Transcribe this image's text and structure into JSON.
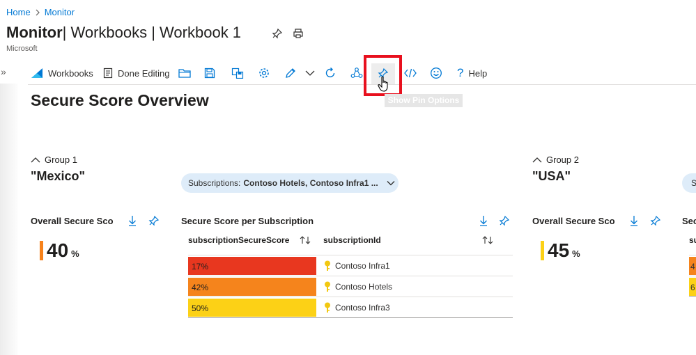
{
  "breadcrumb": {
    "home": "Home",
    "sep": ">",
    "current": "Monitor"
  },
  "title": {
    "main": "Monitor",
    "rest": " | Workbooks | Workbook 1"
  },
  "publisher": "Microsoft",
  "toolbar": {
    "expand_glyph": "»",
    "workbooks_label": "Workbooks",
    "done_editing_label": "Done Editing",
    "help_label": "Help",
    "tooltip": "Show Pin Options"
  },
  "overview_title": "Secure Score Overview",
  "groups": [
    {
      "header": "Group 1",
      "name": "\"Mexico\"",
      "overall_title": "Overall Secure Scor",
      "score": "40",
      "score_unit": "%",
      "score_color": "#f7821b",
      "subscriptions_label": "Subscriptions:",
      "subscriptions_value": "Contoso Hotels, Contoso Infra1 ...",
      "table_title": "Secure Score per Subscription",
      "columns": [
        "subscriptionSecureScore",
        "subscriptionId"
      ],
      "rows": [
        {
          "score": "17%",
          "fraction": 0.17,
          "color": "#e8371f",
          "sub": "Contoso Infra1"
        },
        {
          "score": "42%",
          "fraction": 0.42,
          "color": "#f5841c",
          "sub": "Contoso Hotels"
        },
        {
          "score": "50%",
          "fraction": 0.5,
          "color": "#fcd116",
          "sub": "Contoso Infra3"
        }
      ]
    },
    {
      "header": "Group 2",
      "name": "\"USA\"",
      "overall_title": "Overall Secure Scor",
      "score": "45",
      "score_unit": "%",
      "score_color": "#fcd116",
      "subscriptions_label_cut": "S",
      "table_title_cut": "Sec",
      "column_cut": "su",
      "rows_cut": [
        {
          "text": "4",
          "color": "#f5841c"
        },
        {
          "text": "6",
          "color": "#fcd116"
        }
      ]
    }
  ],
  "colors": {
    "accent": "#0078d4",
    "highlight": "#e8101e",
    "pill": "#deecf9"
  },
  "icons": [
    "chevron-right-icon",
    "pin-icon",
    "print-icon",
    "workbooks-icon",
    "done-editing-icon",
    "open-icon",
    "save-icon",
    "save-as-icon",
    "settings-icon",
    "edit-icon",
    "chevron-down-icon",
    "refresh-icon",
    "share-icon",
    "code-icon",
    "feedback-icon",
    "help-icon",
    "download-icon",
    "sort-icon",
    "key-icon",
    "cursor-icon"
  ]
}
